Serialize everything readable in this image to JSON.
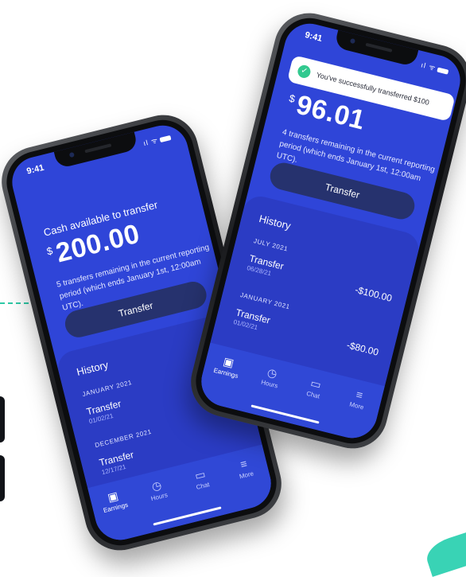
{
  "phone_left": {
    "status_time": "9:41",
    "status_icons": "ıl ᯤ",
    "cash_label": "Cash available to transfer",
    "currency": "$",
    "amount": "200.00",
    "remaining": "5 transfers remaining in the current reporting period (which ends January 1st, 12:00am UTC).",
    "transfer_label": "Transfer",
    "history_title": "History",
    "sections": [
      {
        "label": "JANUARY 2021",
        "items": [
          {
            "title": "Transfer",
            "date": "01/02/21"
          }
        ]
      },
      {
        "label": "DECEMBER 2021",
        "items": [
          {
            "title": "Transfer",
            "date": "12/17/21"
          }
        ]
      }
    ],
    "tabs": [
      {
        "label": "Earnings",
        "icon": "wallet-icon"
      },
      {
        "label": "Hours",
        "icon": "stopwatch-icon"
      },
      {
        "label": "Chat",
        "icon": "chat-icon"
      },
      {
        "label": "More",
        "icon": "menu-icon"
      }
    ]
  },
  "phone_right": {
    "status_time": "9:41",
    "status_icons": "ıl ᯤ",
    "toast": "You've successfully transferred $100",
    "currency": "$",
    "amount": "96.01",
    "remaining": "4 transfers remaining in the current reporting period (which ends January 1st, 12:00am UTC).",
    "transfer_label": "Transfer",
    "history_title": "History",
    "sections": [
      {
        "label": "JULY 2021",
        "items": [
          {
            "title": "Transfer",
            "date": "06/28/21",
            "amount": "-$100.00"
          }
        ]
      },
      {
        "label": "JANUARY 2021",
        "items": [
          {
            "title": "Transfer",
            "date": "01/02/21",
            "amount": "-$80.00"
          }
        ]
      }
    ],
    "tabs": [
      {
        "label": "Earnings",
        "icon": "wallet-icon"
      },
      {
        "label": "Hours",
        "icon": "stopwatch-icon"
      },
      {
        "label": "Chat",
        "icon": "chat-icon"
      },
      {
        "label": "More",
        "icon": "menu-icon"
      }
    ]
  },
  "colors": {
    "screen_blue": "#2f45d8",
    "history_blue": "#2b3cc4",
    "button_navy": "#26326e",
    "accent_teal": "#2ec9a6",
    "toast_check": "#32c98f"
  }
}
